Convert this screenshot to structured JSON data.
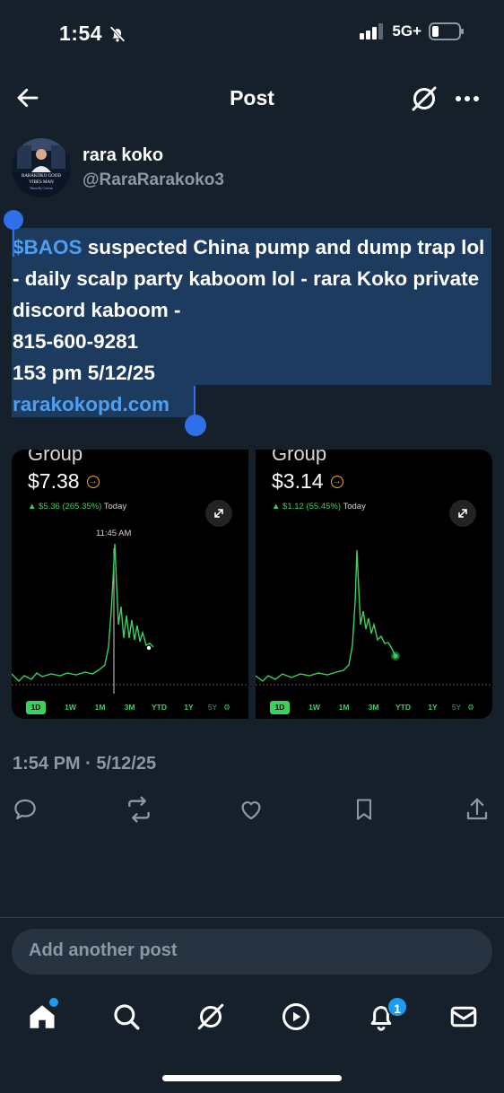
{
  "status_bar": {
    "time": "1:54",
    "network": "5G+"
  },
  "header": {
    "title": "Post"
  },
  "author": {
    "name": "rara koko",
    "handle": "@RaraRarakoko3",
    "avatar_caption_1": "RARAKOKO GOOD",
    "avatar_caption_2": "VIBES MAN",
    "avatar_caption_3": "Naturally Curious"
  },
  "post": {
    "cashtag": "$BAOS",
    "body": " suspected  China pump and dump trap lol - daily scalp party kaboom lol - rara Koko private discord kaboom -",
    "phone": "815-600-9281",
    "stamp": "153 pm 5/12/25",
    "link": "rarakokopd.com",
    "meta": "1:54 PM · 5/12/25"
  },
  "images": [
    {
      "group": "Group",
      "price": "$7.38",
      "change": "▲ $5.36 (265.35%)",
      "today": "Today",
      "time_label": "11:45 AM",
      "tabs": [
        "1D",
        "1W",
        "1M",
        "3M",
        "YTD",
        "1Y",
        "5Y"
      ]
    },
    {
      "group": "Group",
      "price": "$3.14",
      "change": "▲ $1.12 (55.45%)",
      "today": "Today",
      "time_label": "",
      "tabs": [
        "1D",
        "1W",
        "1M",
        "3M",
        "YTD",
        "1Y",
        "5Y"
      ]
    }
  ],
  "reply": {
    "placeholder": "Add another post"
  },
  "nav": {
    "notification_count": "1"
  },
  "icons": [
    "back-arrow-icon",
    "grok-icon",
    "more-icon",
    "reply-icon",
    "repost-icon",
    "like-icon",
    "bookmark-icon",
    "share-icon",
    "home-icon",
    "search-icon",
    "grok-icon",
    "video-icon",
    "notifications-icon",
    "messages-icon"
  ],
  "colors": {
    "background": "#15202b",
    "accent": "#1d9bf0",
    "link": "#4f9ff0",
    "selection": "#1d3a5f",
    "chart_green": "#38d15c"
  }
}
